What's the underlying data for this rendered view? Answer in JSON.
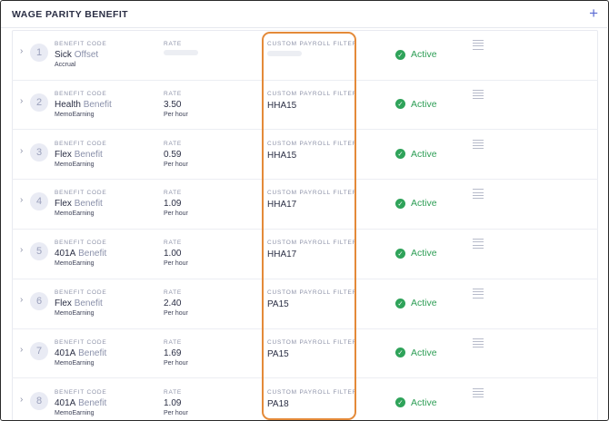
{
  "panel": {
    "title": "WAGE PARITY BENEFIT",
    "add_icon": "plus-icon",
    "accent_color": "#5a6ad2",
    "highlight_color": "#e48a39"
  },
  "columns": {
    "benefit_code": "BENEFIT CODE",
    "rate": "RATE",
    "filter": "CUSTOM PAYROLL FILTER"
  },
  "rows": [
    {
      "num": "1",
      "code_main": "Sick",
      "code_sub": "Offset",
      "type": "Accrual",
      "rate": "",
      "unit": "",
      "filter": "",
      "status": "Active"
    },
    {
      "num": "2",
      "code_main": "Health",
      "code_sub": "Benefit",
      "type": "MemoEarning",
      "rate": "3.50",
      "unit": "Per hour",
      "filter": "HHA15",
      "status": "Active"
    },
    {
      "num": "3",
      "code_main": "Flex",
      "code_sub": "Benefit",
      "type": "MemoEarning",
      "rate": "0.59",
      "unit": "Per hour",
      "filter": "HHA15",
      "status": "Active"
    },
    {
      "num": "4",
      "code_main": "Flex",
      "code_sub": "Benefit",
      "type": "MemoEarning",
      "rate": "1.09",
      "unit": "Per hour",
      "filter": "HHA17",
      "status": "Active"
    },
    {
      "num": "5",
      "code_main": "401A",
      "code_sub": "Benefit",
      "type": "MemoEarning",
      "rate": "1.00",
      "unit": "Per hour",
      "filter": "HHA17",
      "status": "Active"
    },
    {
      "num": "6",
      "code_main": "Flex",
      "code_sub": "Benefit",
      "type": "MemoEarning",
      "rate": "2.40",
      "unit": "Per hour",
      "filter": "PA15",
      "status": "Active"
    },
    {
      "num": "7",
      "code_main": "401A",
      "code_sub": "Benefit",
      "type": "MemoEarning",
      "rate": "1.69",
      "unit": "Per hour",
      "filter": "PA15",
      "status": "Active"
    },
    {
      "num": "8",
      "code_main": "401A",
      "code_sub": "Benefit",
      "type": "MemoEarning",
      "rate": "1.09",
      "unit": "Per hour",
      "filter": "PA18",
      "status": "Active"
    }
  ]
}
